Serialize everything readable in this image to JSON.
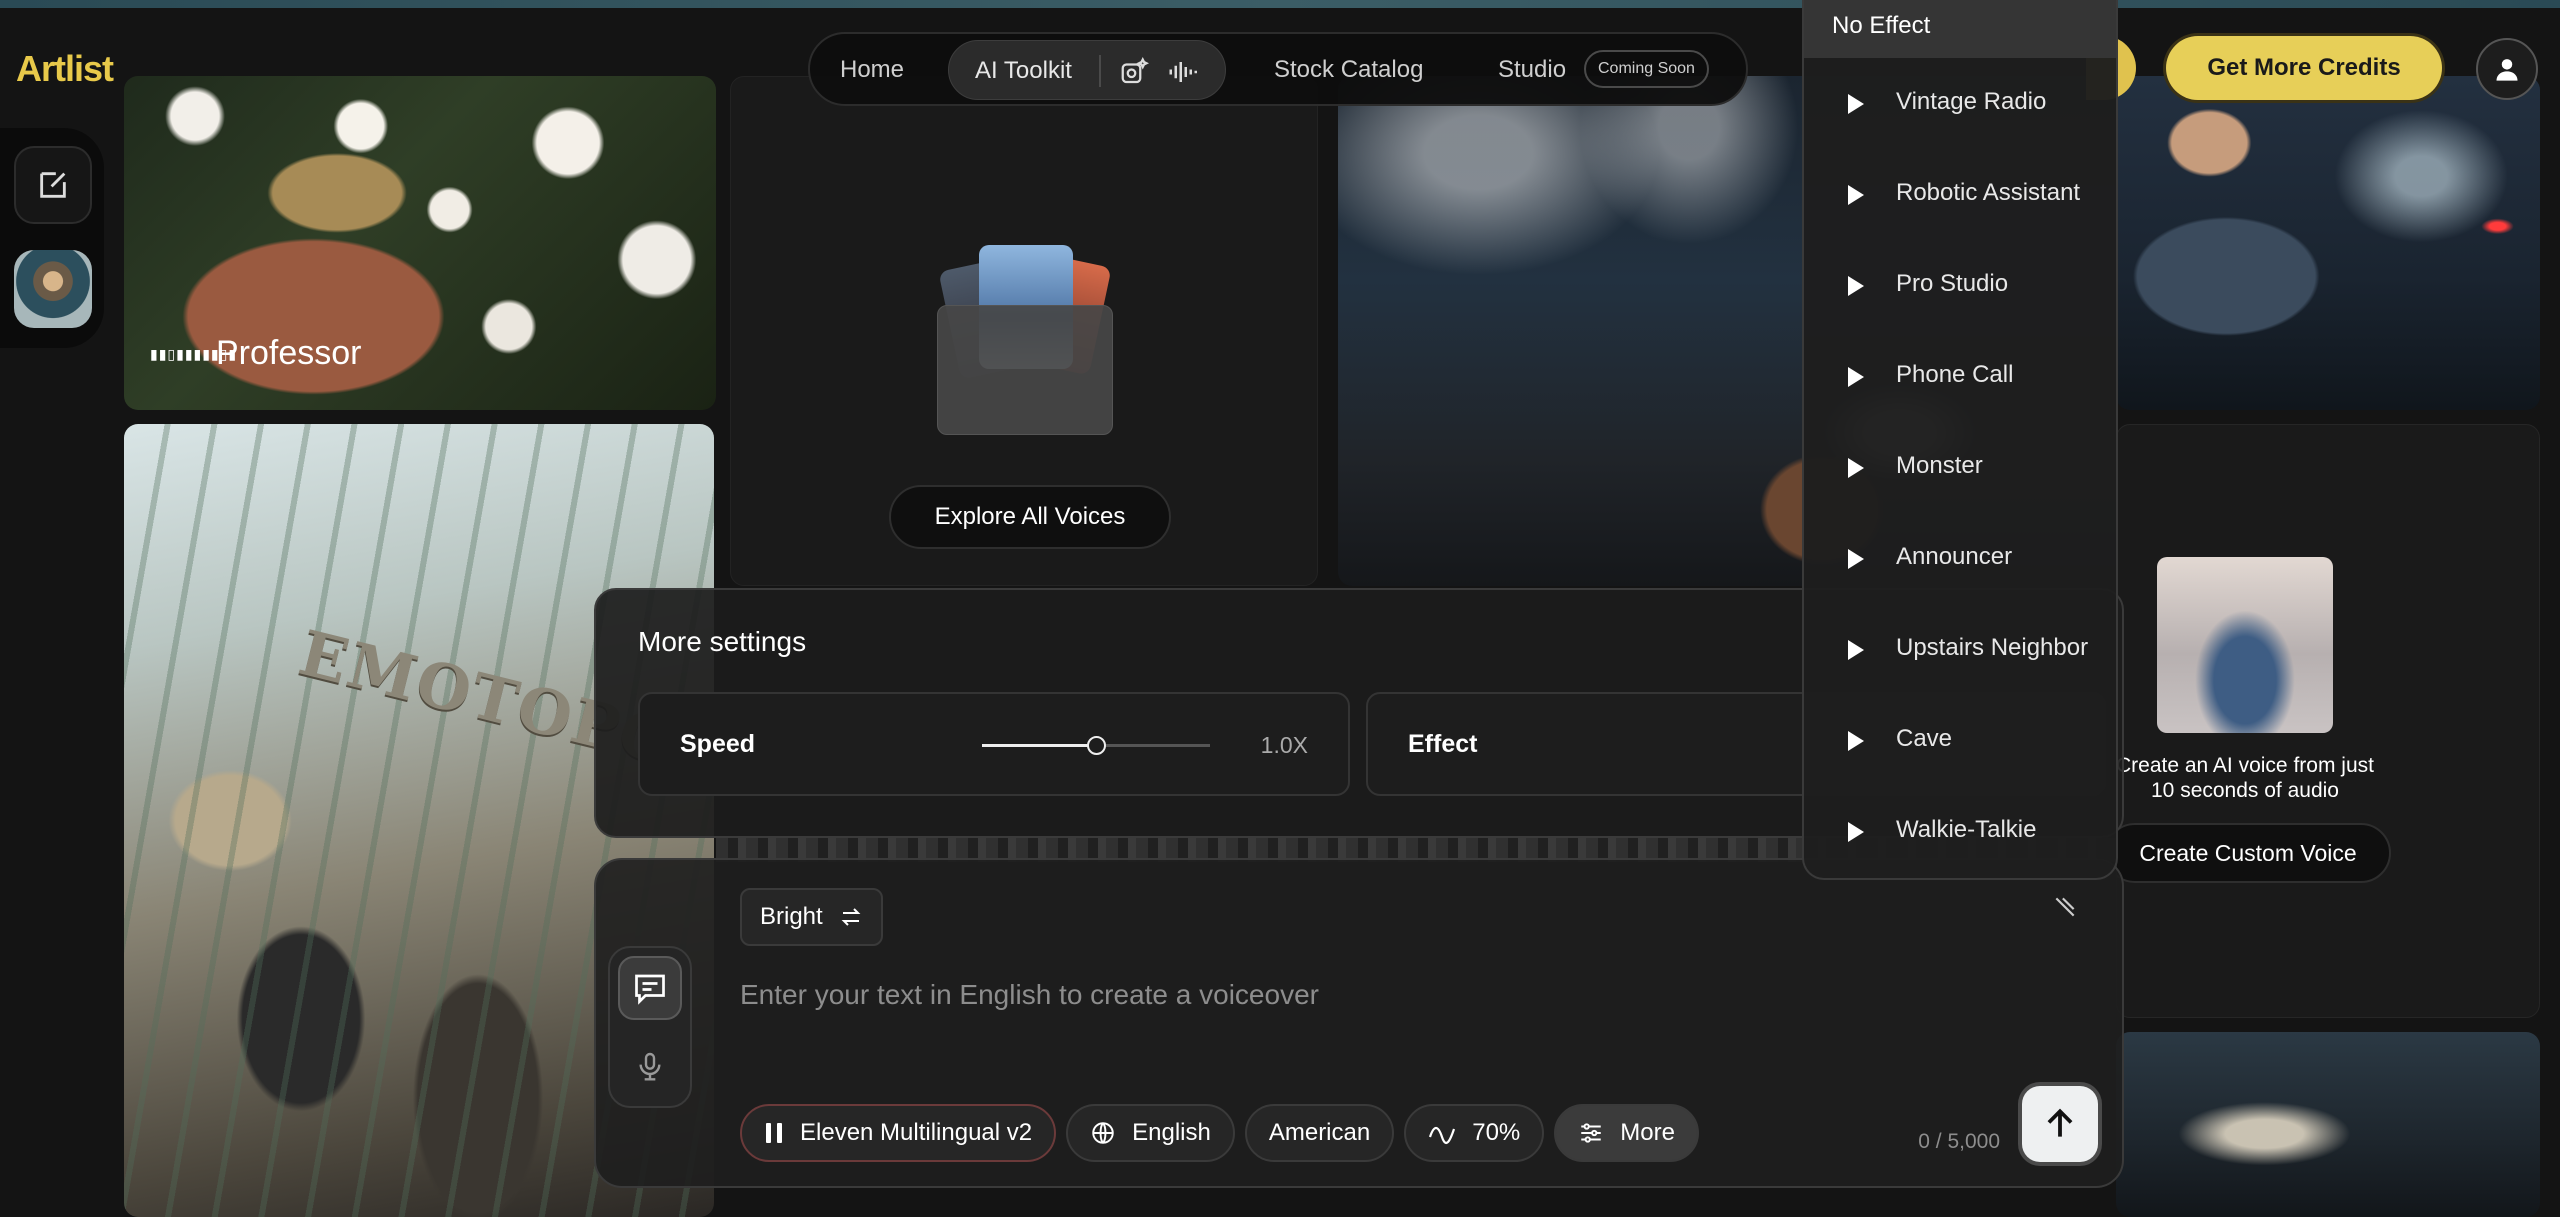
{
  "brand": {
    "logo": "Artlist"
  },
  "nav": {
    "home": "Home",
    "toolkit": "AI Toolkit",
    "stock": "Stock Catalog",
    "studio": "Studio",
    "studio_badge": "Coming Soon"
  },
  "header": {
    "credits_button": "Get More Credits"
  },
  "gallery": {
    "professor_label": "Professor",
    "emotopods_sign": "EMOTOPODS",
    "explore_button": "Explore All Voices",
    "custom_voice_text": "Create an AI voice from just 10 seconds of audio",
    "custom_voice_button": "Create Custom Voice"
  },
  "settings": {
    "title": "More settings",
    "speed_label": "Speed",
    "speed_value": "1.0X",
    "speed_slider_fraction": 0.5,
    "effect_label": "Effect"
  },
  "composer": {
    "style_button": "Bright",
    "placeholder": "Enter your text in English to create a voiceover",
    "model": "Eleven Multilingual v2",
    "language": "English",
    "accent": "American",
    "stability": "70%",
    "more": "More",
    "char_count": "0 / 5,000"
  },
  "effects_dropdown": {
    "selected": "No Effect",
    "items": [
      "Vintage Radio",
      "Robotic Assistant",
      "Pro Studio",
      "Phone Call",
      "Monster",
      "Announcer",
      "Upstairs Neighbor",
      "Cave",
      "Walkie-Talkie"
    ]
  },
  "colors": {
    "accent": "#e7cf58",
    "background": "#141414"
  }
}
